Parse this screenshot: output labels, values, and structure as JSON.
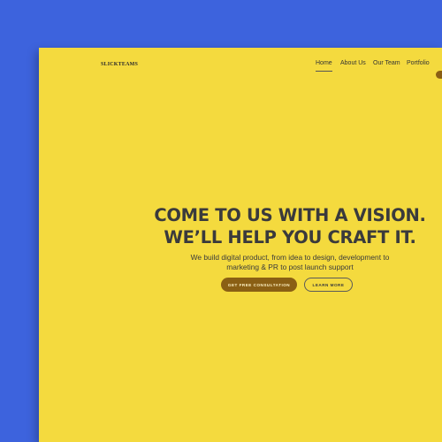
{
  "logo": "SLICKTEAMS",
  "nav": {
    "items": [
      {
        "label": "Home",
        "active": true
      },
      {
        "label": "About Us",
        "active": false
      },
      {
        "label": "Our Team",
        "active": false
      },
      {
        "label": "Portfolio",
        "active": false
      }
    ]
  },
  "hero": {
    "headline_line1": "COME TO US WITH A VISION.",
    "headline_line2": "WE’LL HELP YOU CRAFT IT.",
    "subtitle_line1": "We build digital product, from idea to design, development to",
    "subtitle_line2": "marketing & PR to post launch support",
    "primary_cta": "GET FREE CONSULTATION",
    "secondary_cta": "LEARN MORE"
  },
  "colors": {
    "background": "#3d63dd",
    "page": "#f4da3e",
    "accent": "#8a5f14",
    "text": "#3a3a3c"
  }
}
